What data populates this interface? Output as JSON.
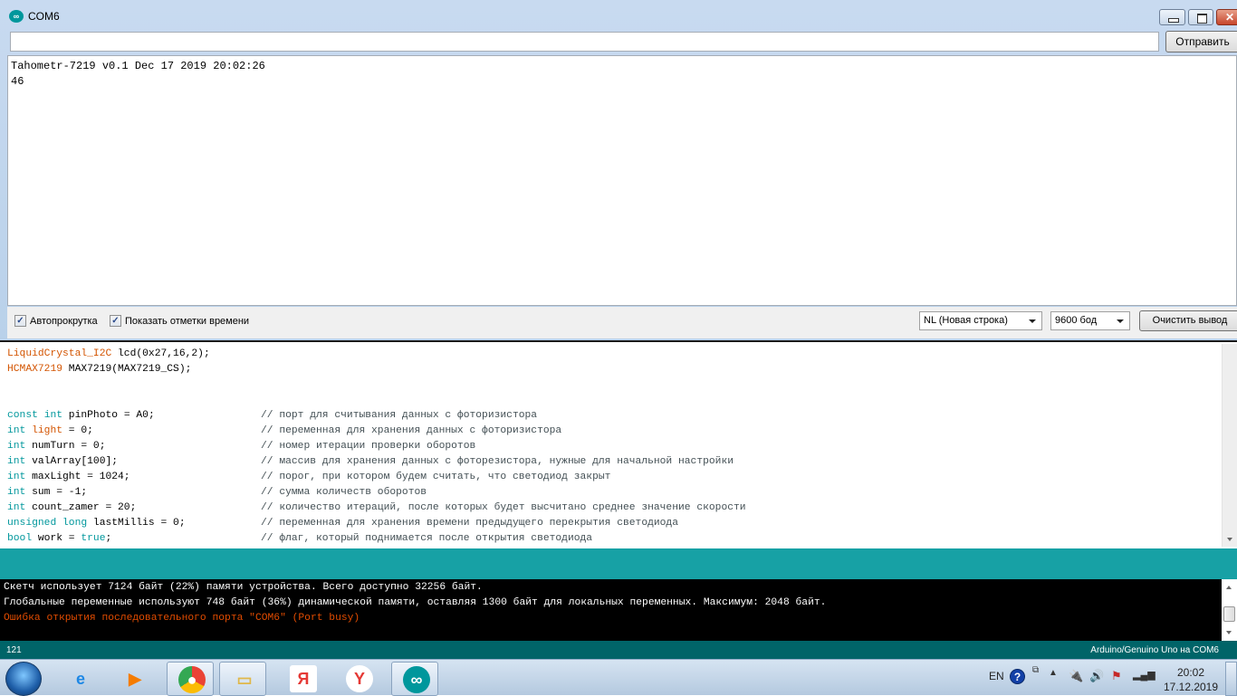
{
  "serial_monitor": {
    "title": "COM6",
    "input_value": "",
    "send_label": "Отправить",
    "output_lines": [
      "Tahometr-7219 v0.1 Dec 17 2019 20:02:26",
      "46"
    ],
    "autoscroll_label": "Автопрокрутка",
    "autoscroll_checked": true,
    "timestamps_label": "Показать отметки времени",
    "timestamps_checked": true,
    "line_ending": "NL (Новая строка)",
    "baud_rate": "9600 бод",
    "clear_label": "Очистить вывод"
  },
  "editor": {
    "lines": [
      {
        "code": [
          {
            "t": "LiquidCrystal_I2C",
            "c": "ty"
          },
          {
            "t": " lcd(0x27,16,2);",
            "c": ""
          }
        ],
        "comment": ""
      },
      {
        "code": [
          {
            "t": "HCMAX7219",
            "c": "ty"
          },
          {
            "t": " MAX7219(MAX7219_CS);",
            "c": ""
          }
        ],
        "comment": ""
      },
      {
        "code": [],
        "comment": ""
      },
      {
        "code": [],
        "comment": ""
      },
      {
        "code": [
          {
            "t": "const",
            "c": "kw"
          },
          {
            "t": " ",
            "c": ""
          },
          {
            "t": "int",
            "c": "kw"
          },
          {
            "t": " pinPhoto = A0;",
            "c": ""
          }
        ],
        "comment": "// порт для считывания данных с фоторизистора"
      },
      {
        "code": [
          {
            "t": "int",
            "c": "kw"
          },
          {
            "t": " ",
            "c": ""
          },
          {
            "t": "light",
            "c": "ty"
          },
          {
            "t": " = 0;",
            "c": ""
          }
        ],
        "comment": "// переменная для хранения данных с фоторизистора"
      },
      {
        "code": [
          {
            "t": "int",
            "c": "kw"
          },
          {
            "t": " numTurn = 0;",
            "c": ""
          }
        ],
        "comment": "// номер итерации проверки оборотов"
      },
      {
        "code": [
          {
            "t": "int",
            "c": "kw"
          },
          {
            "t": " valArray[100];",
            "c": ""
          }
        ],
        "comment": "// массив для хранения данных с фоторезистора, нужные для начальной настройки"
      },
      {
        "code": [
          {
            "t": "int",
            "c": "kw"
          },
          {
            "t": " maxLight = 1024;",
            "c": ""
          }
        ],
        "comment": "// порог, при котором будем считать, что светодиод закрыт"
      },
      {
        "code": [
          {
            "t": "int",
            "c": "kw"
          },
          {
            "t": " sum = -1;",
            "c": ""
          }
        ],
        "comment": "// сумма количеств оборотов"
      },
      {
        "code": [
          {
            "t": "int",
            "c": "kw"
          },
          {
            "t": " count_zamer = 20;",
            "c": ""
          }
        ],
        "comment": "// количество итераций, после которых будет высчитано среднее значение скорости"
      },
      {
        "code": [
          {
            "t": "unsigned",
            "c": "kw"
          },
          {
            "t": " ",
            "c": ""
          },
          {
            "t": "long",
            "c": "kw"
          },
          {
            "t": " lastMillis = 0;",
            "c": ""
          }
        ],
        "comment": "// переменная для хранения времени предыдущего перекрытия светодиода"
      },
      {
        "code": [
          {
            "t": "bool",
            "c": "kw"
          },
          {
            "t": " work = ",
            "c": ""
          },
          {
            "t": "true",
            "c": "kw"
          },
          {
            "t": ";",
            "c": ""
          }
        ],
        "comment": "// флаг, который поднимается после открытия светодиода"
      }
    ]
  },
  "console": {
    "lines": [
      {
        "text": "Скетч использует 7124 байт (22%) памяти устройства. Всего доступно 32256 байт.",
        "type": "info"
      },
      {
        "text": "Глобальные переменные используют 748 байт (36%) динамической памяти, оставляя 1300 байт для локальных переменных. Максимум: 2048 байт.",
        "type": "info"
      },
      {
        "text": "Ошибка открытия последовательного порта \"COM6\" (Port busy)",
        "type": "error"
      }
    ]
  },
  "status_bar": {
    "line_number": "121",
    "board": "Arduino/Genuino Uno на COM6"
  },
  "taskbar": {
    "apps": [
      {
        "name": "internet-explorer",
        "glyph": "e",
        "color": "#1e88e5",
        "active": false
      },
      {
        "name": "media-player",
        "glyph": "▶",
        "color": "#f57c00",
        "active": false
      },
      {
        "name": "chrome",
        "glyph": "●",
        "color": "#4285f4",
        "active": true
      },
      {
        "name": "file-explorer",
        "glyph": "▭",
        "color": "#e0b84a",
        "active": true
      },
      {
        "name": "yandex",
        "glyph": "Я",
        "color": "#e53935",
        "active": false
      },
      {
        "name": "yandex-browser",
        "glyph": "Y",
        "color": "#e53935",
        "active": false
      },
      {
        "name": "arduino",
        "glyph": "∞",
        "color": "#00979c",
        "active": true
      }
    ],
    "language": "EN",
    "time": "20:02",
    "date": "17.12.2019"
  },
  "colors": {
    "arduino_teal": "#00979c",
    "message_bar": "#17a1a5",
    "status_bar": "#006468",
    "error_text": "#e34c00",
    "type_orange": "#d35400"
  }
}
